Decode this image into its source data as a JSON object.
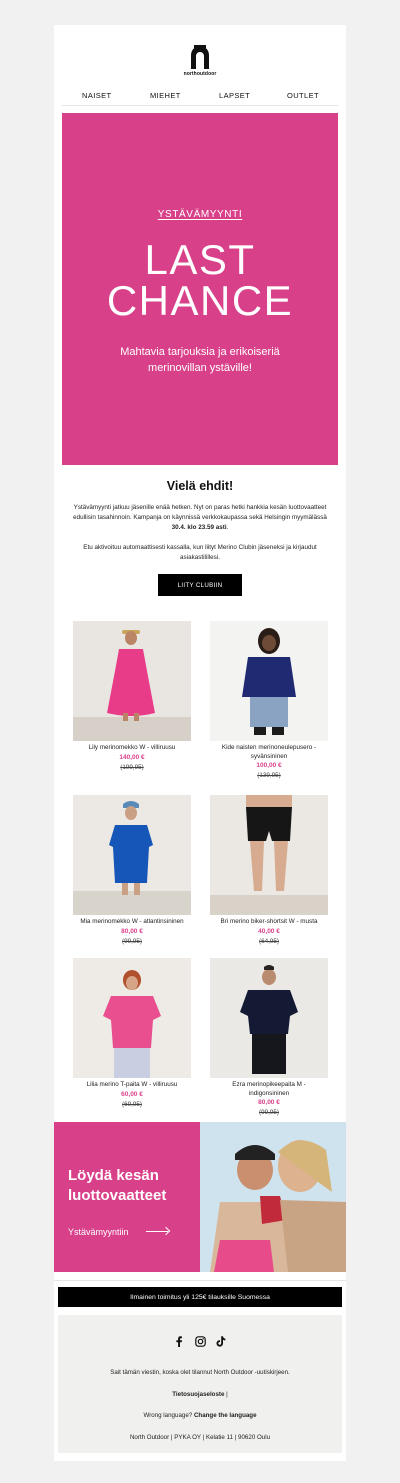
{
  "brand": {
    "logo_text": "northoutdoor"
  },
  "nav": {
    "items": [
      "NAISET",
      "MIEHET",
      "LAPSET",
      "OUTLET"
    ]
  },
  "hero": {
    "kicker": "YSTÄVÄMYYNTI",
    "title_line1": "LAST",
    "title_line2": "CHANCE",
    "subtitle": "Mahtavia tarjouksia ja erikoiseriä merinovillan ystäville!",
    "bg_color": "#d9408a"
  },
  "intro": {
    "title": "Vielä ehdit!",
    "para1": "Ystävämyynti jatkuu jäsenille enää hetken. Nyt on paras hetki hankkia kesän luottovaatteet edullisin tasahinnoin. Kampanja on käynnissä verkkokaupassa sekä Helsingin myymälässä",
    "para1_bold": "30.4. klo 23.59 asti",
    "para1_end": ".",
    "para2": "Etu aktivoituu automaattisesti kassalla, kun liityt Merino Clubin jäseneksi ja kirjaudut asiakastilillesi.",
    "cta_label": "LIITY CLUBIIN"
  },
  "products": [
    {
      "name": "Lily merinomekko W - villiruusu",
      "price": "140,00 €",
      "old_price": "(199,95)"
    },
    {
      "name": "Kide naisten merinoneulepusero - syvänsininen",
      "price": "100,00 €",
      "old_price": "(139,95)"
    },
    {
      "name": "Mia merinomekko W - atlantinsininen",
      "price": "80,00 €",
      "old_price": "(99,95)"
    },
    {
      "name": "Bri merino biker-shortsit W - musta",
      "price": "40,00 €",
      "old_price": "(64,95)"
    },
    {
      "name": "Lilia merino T-paita W - villiruusu",
      "price": "60,00 €",
      "old_price": "(69,95)"
    },
    {
      "name": "Ezra merinopikeepaita M - indigonsininen",
      "price": "80,00 €",
      "old_price": "(99,95)"
    }
  ],
  "promo": {
    "title": "Löydä kesän luottovaatteet",
    "link": "Ystävämyyntiin"
  },
  "shipping": {
    "text": "Ilmainen toimitus yli 125€ tilauksille Suomessa"
  },
  "footer": {
    "social_icons": [
      "facebook-icon",
      "instagram-icon",
      "tiktok-icon"
    ],
    "reason": "Sait tämän viestin, koska olet tilannut North Outdoor -uutiskirjeen.",
    "privacy": "Tietosuojaseloste",
    "privacy_sep": "|",
    "language_prefix": "Wrong language?",
    "language_link": "Change the language",
    "address": "North Outdoor | PYKA OY | Kelatie 11 | 90620 Oulu"
  },
  "colors": {
    "accent": "#d9408a",
    "black": "#000000",
    "footer_bg": "#f0f1ef"
  }
}
